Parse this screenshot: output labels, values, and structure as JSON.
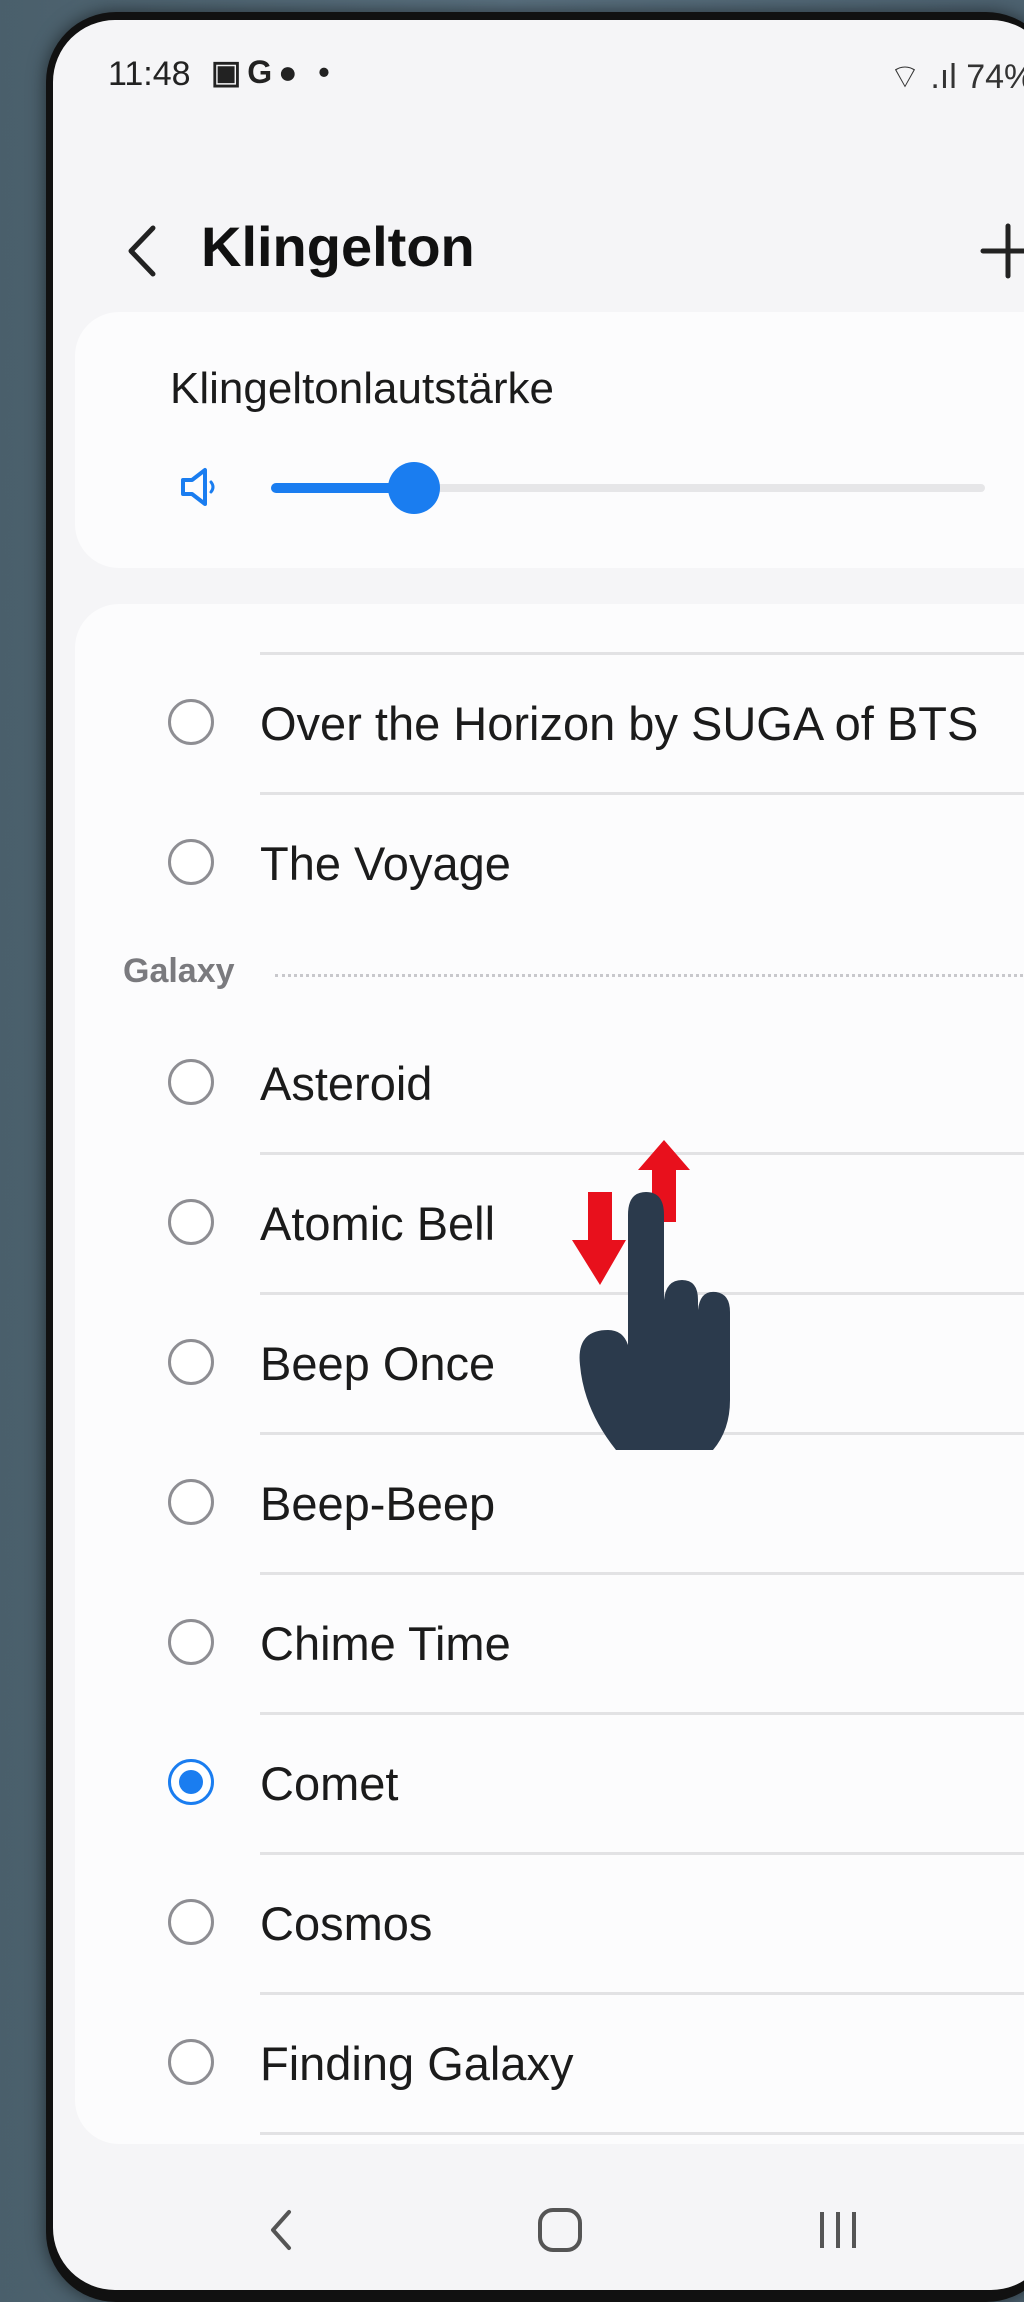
{
  "status_bar": {
    "time": "11:48",
    "notification_icons": [
      "image-icon",
      "google-icon",
      "chat-icon",
      "dot-icon"
    ],
    "icons_text": "▣G● •",
    "battery": "74%",
    "right_text": "⌔ .ıl 74%▮"
  },
  "header": {
    "back_icon": "chevron-left-icon",
    "title": "Klingelton",
    "add_icon": "plus-icon"
  },
  "volume": {
    "label": "Klingeltonlautstärke",
    "icon": "speaker-icon",
    "level": 0.2,
    "accent": "#1a7df0"
  },
  "ringtones": {
    "items_before": [
      {
        "label": "Over the Horizon by SUGA of BTS",
        "selected": false
      },
      {
        "label": "The Voyage",
        "selected": false
      }
    ],
    "section": "Galaxy",
    "items": [
      {
        "label": "Asteroid",
        "selected": false
      },
      {
        "label": "Atomic Bell",
        "selected": false
      },
      {
        "label": "Beep Once",
        "selected": false
      },
      {
        "label": "Beep-Beep",
        "selected": false
      },
      {
        "label": "Chime Time",
        "selected": false
      },
      {
        "label": "Comet",
        "selected": true
      },
      {
        "label": "Cosmos",
        "selected": false
      },
      {
        "label": "Finding Galaxy",
        "selected": false
      }
    ]
  },
  "nav_bar": {
    "back": "nav-back-icon",
    "home": "nav-home-icon",
    "recents": "nav-recents-icon"
  },
  "overlay": {
    "gesture": "swipe-up-down-hand-icon",
    "arrow_color": "#e8101c",
    "hand_color": "#2b3a4c"
  }
}
